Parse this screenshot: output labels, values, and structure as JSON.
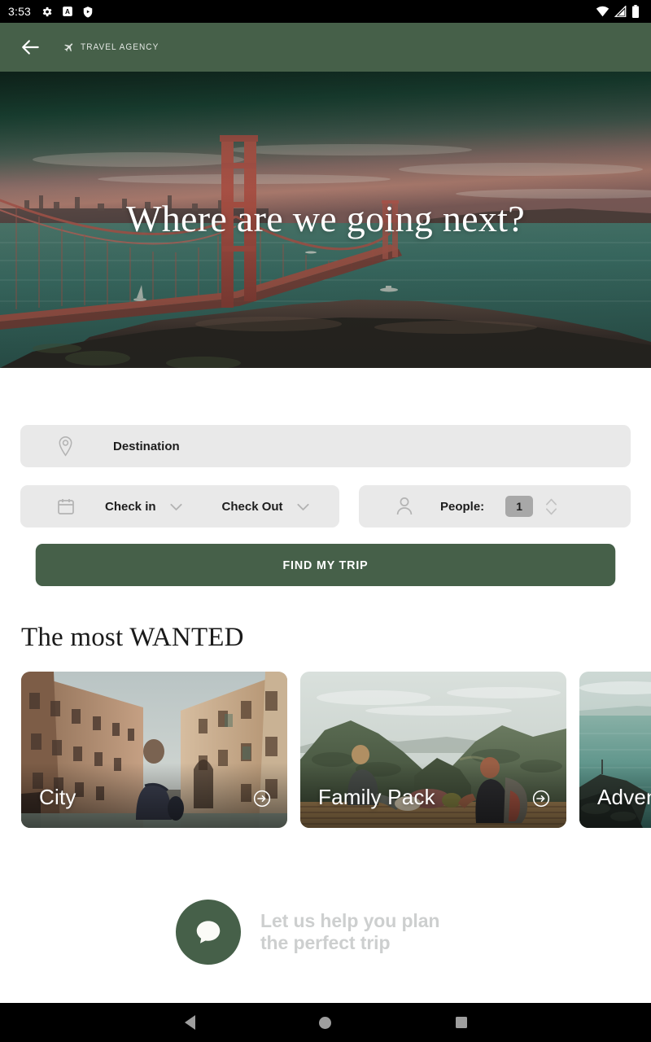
{
  "status_bar": {
    "time": "3:53",
    "left_icons": [
      "gear-icon",
      "a-badge-icon",
      "shield-play-icon"
    ],
    "right_icons": [
      "wifi-icon",
      "cellular-signal-icon",
      "battery-icon"
    ]
  },
  "app_bar": {
    "back_icon": "back-arrow-icon",
    "brand_icon": "airplane-icon",
    "brand_text": "TRAVEL AGENCY",
    "background_color": "#466049"
  },
  "hero": {
    "title": "Where are we going next?",
    "image_alt": "golden-gate-bridge-sunset"
  },
  "search_form": {
    "destination": {
      "icon": "location-pin-icon",
      "value": "Destination",
      "placeholder": "Destination"
    },
    "check_in": {
      "icon": "calendar-icon",
      "label": "Check in",
      "chevron": "chevron-down-icon"
    },
    "check_out": {
      "label": "Check Out",
      "chevron": "chevron-down-icon"
    },
    "people": {
      "icon": "person-icon",
      "label": "People:",
      "count": "1",
      "stepper": "up-down-stepper-icon"
    },
    "submit_label": "FIND MY TRIP"
  },
  "wanted_section": {
    "heading": "The most WANTED",
    "cards": [
      {
        "label": "City",
        "arrow_icon": "arrow-right-circle-icon",
        "image_alt": "venice-canal-street"
      },
      {
        "label": "Family Pack",
        "arrow_icon": "arrow-right-circle-icon",
        "image_alt": "mountain-viewpoint-friends"
      },
      {
        "label": "Adventure",
        "arrow_icon": "arrow-right-circle-icon",
        "image_alt": "coastal-cliff-sea"
      }
    ]
  },
  "chat_cta": {
    "icon": "chat-bubble-icon",
    "line1": "Let us help you plan",
    "line2": "the perfect trip",
    "circle_color": "#466049"
  },
  "nav_bar": {
    "back": "nav-back-icon",
    "home": "nav-home-icon",
    "recents": "nav-recents-icon"
  }
}
